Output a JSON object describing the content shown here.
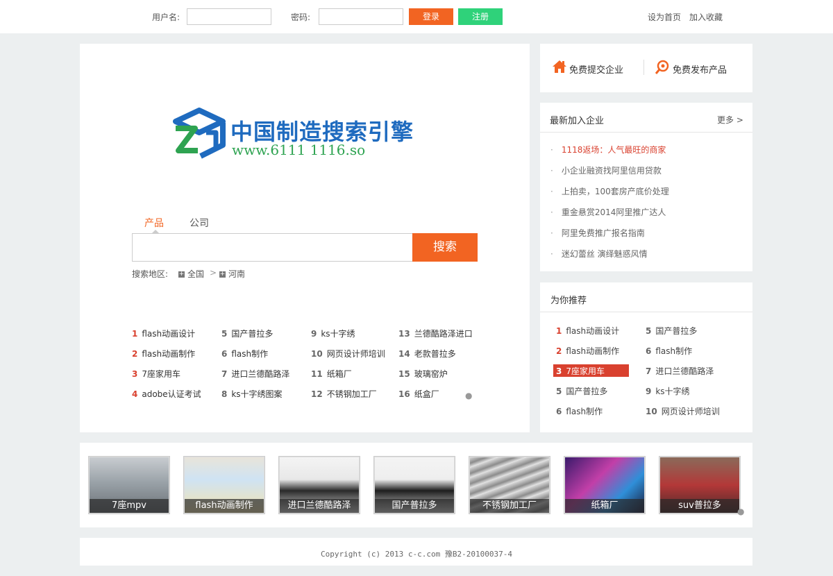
{
  "header": {
    "username_label": "用户名:",
    "password_label": "密码:",
    "login": "登录",
    "register": "注册",
    "set_home": "设为首页",
    "add_fav": "加入收藏",
    "colors": {
      "login": "#f26422",
      "register": "#2fd27a"
    }
  },
  "logo": {
    "name": "中国制造搜索引擎",
    "url": "www.6111 1116.so"
  },
  "search": {
    "tabs": [
      "产品",
      "公司"
    ],
    "button": "搜索",
    "region_label": "搜索地区:",
    "region_all": "全国",
    "region_sel": "河南"
  },
  "hot": [
    [
      {
        "n": "1",
        "t": "flash动画设计"
      },
      {
        "n": "2",
        "t": "flash动画制作"
      },
      {
        "n": "3",
        "t": "7座家用车"
      },
      {
        "n": "4",
        "t": "adobe认证考试"
      }
    ],
    [
      {
        "n": "5",
        "t": "国产普拉多"
      },
      {
        "n": "6",
        "t": "flash制作"
      },
      {
        "n": "7",
        "t": "进口兰德酷路泽"
      },
      {
        "n": "8",
        "t": "ks十字绣图案"
      }
    ],
    [
      {
        "n": "9",
        "t": "ks十字绣"
      },
      {
        "n": "10",
        "t": "网页设计师培训"
      },
      {
        "n": "11",
        "t": "纸箱厂"
      },
      {
        "n": "12",
        "t": "不锈钢加工厂"
      }
    ],
    [
      {
        "n": "13",
        "t": "兰德酷路泽进口"
      },
      {
        "n": "14",
        "t": "老款普拉多"
      },
      {
        "n": "15",
        "t": "玻璃窑炉"
      },
      {
        "n": "16",
        "t": "纸盒厂"
      }
    ]
  ],
  "actions": {
    "submit_company": "免费提交企业",
    "publish_product": "免费发布产品"
  },
  "latest": {
    "title": "最新加入企业",
    "more": "更多",
    "items": [
      "1118返场：人气最旺的商家",
      "小企业融资找阿里信用贷款",
      "上拍卖，100套房产底价处理",
      "重金悬赏2014阿里推广达人",
      "阿里免费推广报名指南",
      "迷幻蕾丝 演绎魅惑风情"
    ]
  },
  "recommend": {
    "title": "为你推荐",
    "left": [
      {
        "n": "1",
        "t": "flash动画设计"
      },
      {
        "n": "2",
        "t": "flash动画制作"
      },
      {
        "n": "3",
        "t": "7座家用车"
      },
      {
        "n": "5",
        "t": "国产普拉多"
      },
      {
        "n": "6",
        "t": "flash制作"
      }
    ],
    "right": [
      {
        "n": "5",
        "t": "国产普拉多"
      },
      {
        "n": "6",
        "t": "flash制作"
      },
      {
        "n": "7",
        "t": "进口兰德酷路泽"
      },
      {
        "n": "9",
        "t": "ks十字绣"
      },
      {
        "n": "10",
        "t": "网页设计师培训"
      }
    ]
  },
  "thumbs": [
    "7座mpv",
    "flash动画制作",
    "进口兰德酷路泽",
    "国产普拉多",
    "不锈钢加工厂",
    "纸箱厂",
    "suv普拉多"
  ],
  "footer": "Copyright (c) 2013 c-c.com 豫B2-20100037-4"
}
